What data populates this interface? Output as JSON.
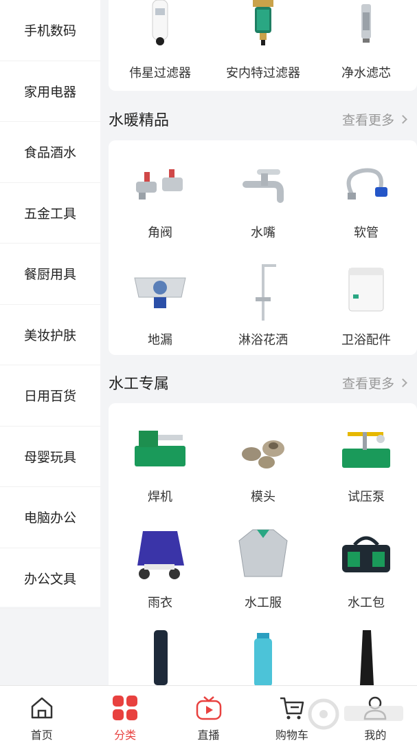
{
  "sidebar": {
    "items": [
      {
        "label": "手机数码"
      },
      {
        "label": "家用电器"
      },
      {
        "label": "食品酒水"
      },
      {
        "label": "五金工具"
      },
      {
        "label": "餐厨用具"
      },
      {
        "label": "美妆护肤"
      },
      {
        "label": "日用百货"
      },
      {
        "label": "母婴玩具"
      },
      {
        "label": "电脑办公"
      },
      {
        "label": "办公文具"
      }
    ]
  },
  "top_card": {
    "items": [
      {
        "label": "伟星过滤器"
      },
      {
        "label": "安内特过滤器"
      },
      {
        "label": "净水滤芯"
      }
    ]
  },
  "sections": [
    {
      "title": "水暖精品",
      "more": "查看更多",
      "items": [
        {
          "label": "角阀"
        },
        {
          "label": "水嘴"
        },
        {
          "label": "软管"
        },
        {
          "label": "地漏"
        },
        {
          "label": "淋浴花洒"
        },
        {
          "label": "卫浴配件"
        }
      ]
    },
    {
      "title": "水工专属",
      "more": "查看更多",
      "items": [
        {
          "label": "焊机"
        },
        {
          "label": "模头"
        },
        {
          "label": "试压泵"
        },
        {
          "label": "雨衣"
        },
        {
          "label": "水工服"
        },
        {
          "label": "水工包"
        }
      ]
    }
  ],
  "tabbar": {
    "tabs": [
      {
        "label": "首页",
        "icon": "home-icon"
      },
      {
        "label": "分类",
        "icon": "category-icon"
      },
      {
        "label": "直播",
        "icon": "live-icon"
      },
      {
        "label": "购物车",
        "icon": "cart-icon"
      },
      {
        "label": "我的",
        "icon": "user-icon"
      }
    ],
    "active_index": 1
  },
  "colors": {
    "accent": "#e8413f",
    "background": "#f3f4f6"
  }
}
